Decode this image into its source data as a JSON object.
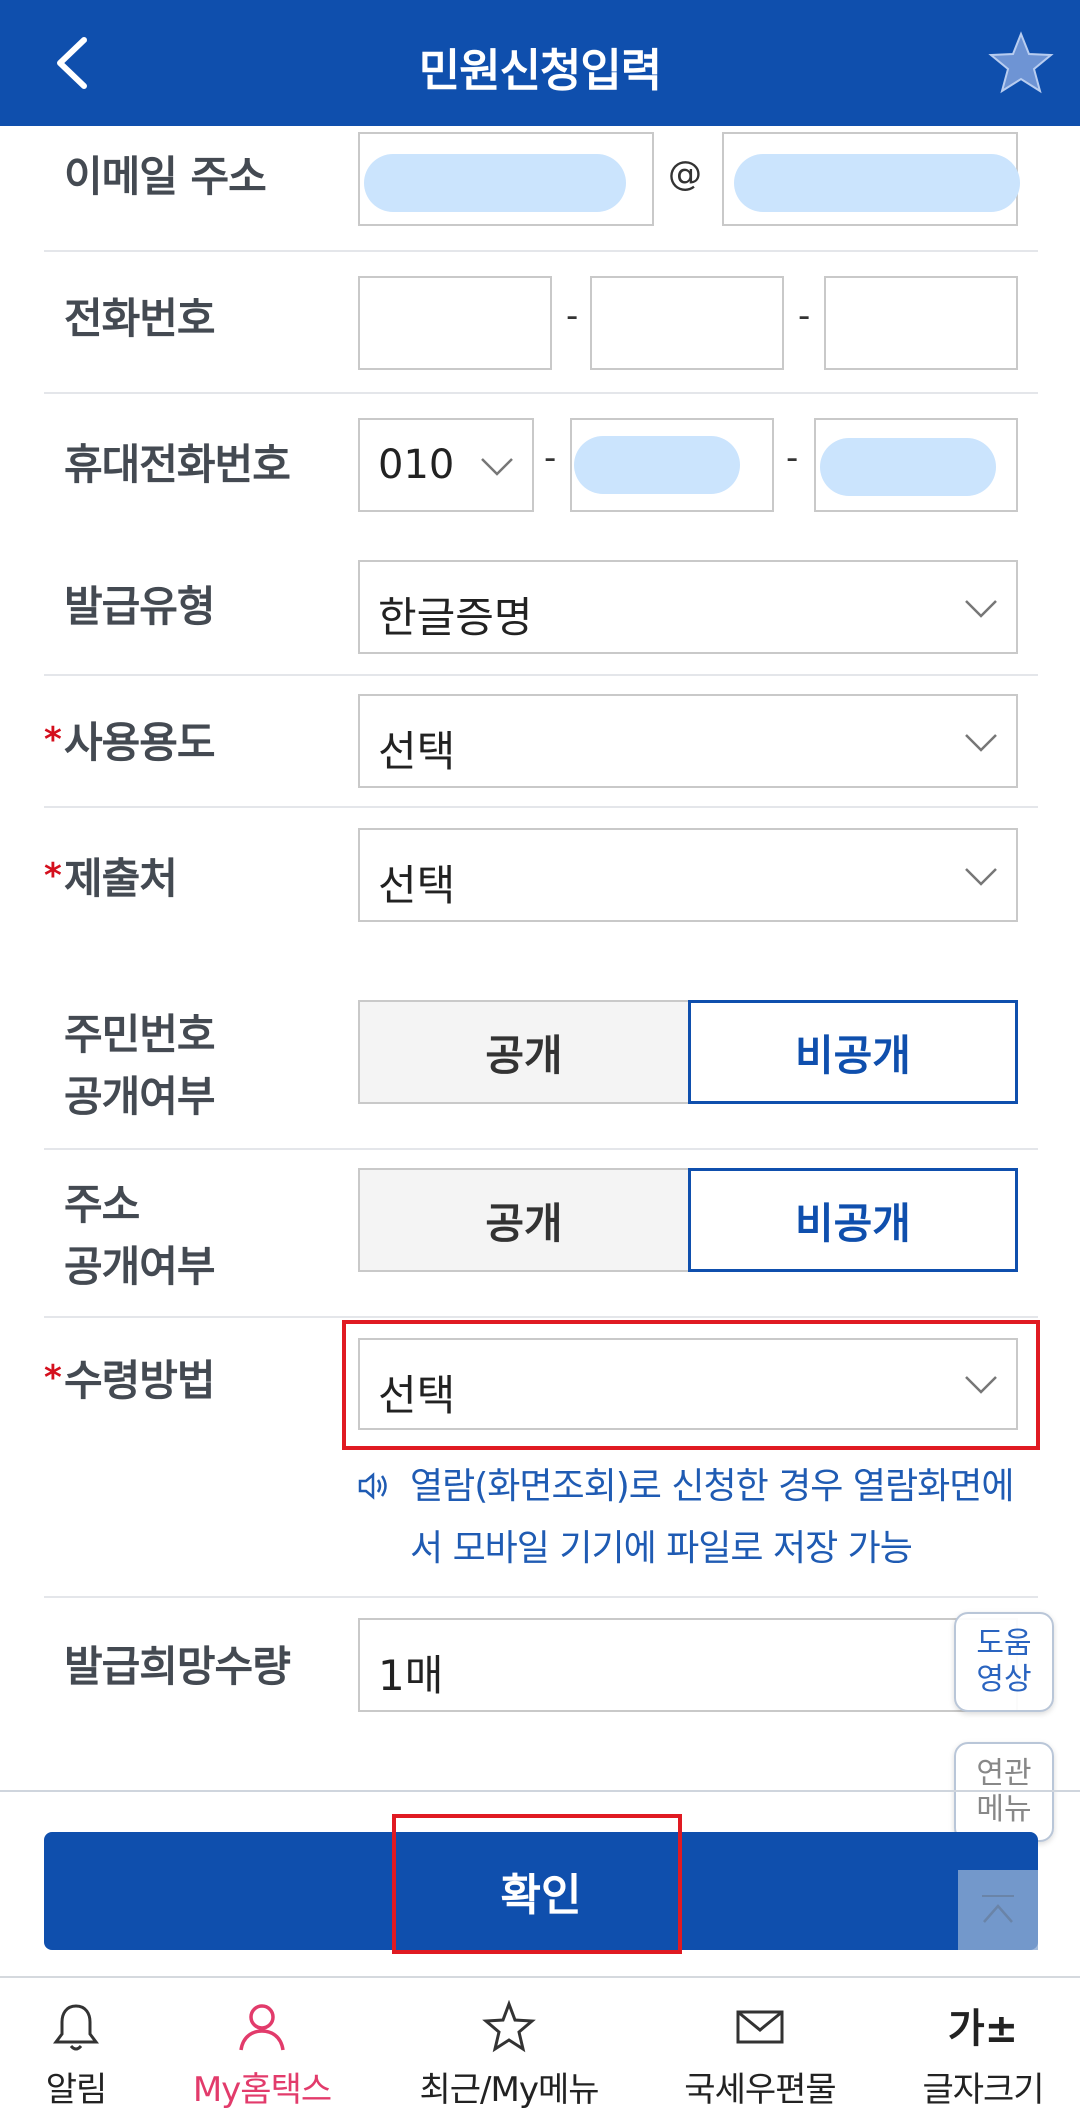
{
  "header": {
    "title": "민원신청입력"
  },
  "email": {
    "label": "이메일 주소",
    "at": "@"
  },
  "phone": {
    "label": "전화번호",
    "dash": "-"
  },
  "mobile": {
    "label": "휴대전화번호",
    "prefix": "010",
    "dash": "-"
  },
  "issue_type": {
    "label": "발급유형",
    "value": "한글증명"
  },
  "purpose": {
    "required": "*",
    "label": "사용용도",
    "value": "선택"
  },
  "submit_to": {
    "required": "*",
    "label": "제출처",
    "value": "선택"
  },
  "rrn_public": {
    "label_line1": "주민번호",
    "label_line2": "공개여부",
    "option_public": "공개",
    "option_private": "비공개",
    "selected": "비공개"
  },
  "addr_public": {
    "label_line1": "주소",
    "label_line2": "공개여부",
    "option_public": "공개",
    "option_private": "비공개",
    "selected": "비공개"
  },
  "receive_method": {
    "required": "*",
    "label": "수령방법",
    "value": "선택",
    "note": "열람(화면조회)로 신청한 경우 열람화면에서 모바일 기기에 파일로 저장 가능"
  },
  "quantity": {
    "label": "발급희망수량",
    "value": "1매"
  },
  "side": {
    "help_line1": "도움",
    "help_line2": "영상",
    "related_line1": "연관",
    "related_line2": "메뉴"
  },
  "confirm_label": "확인",
  "tabs": [
    {
      "label": "알림",
      "icon": "bell-icon"
    },
    {
      "label": "My홈택스",
      "icon": "person-icon",
      "active": true
    },
    {
      "label": "최근/My메뉴",
      "icon": "star-icon"
    },
    {
      "label": "국세우편물",
      "icon": "mail-icon"
    },
    {
      "label": "글자크기",
      "icon": "text-size-icon",
      "glyph": "가±"
    }
  ],
  "colors": {
    "primary": "#0f4fad",
    "required": "#d40f1d",
    "highlight": "#e01a22",
    "active_tab": "#e23b6b",
    "blurred": "#cbe4fd"
  }
}
